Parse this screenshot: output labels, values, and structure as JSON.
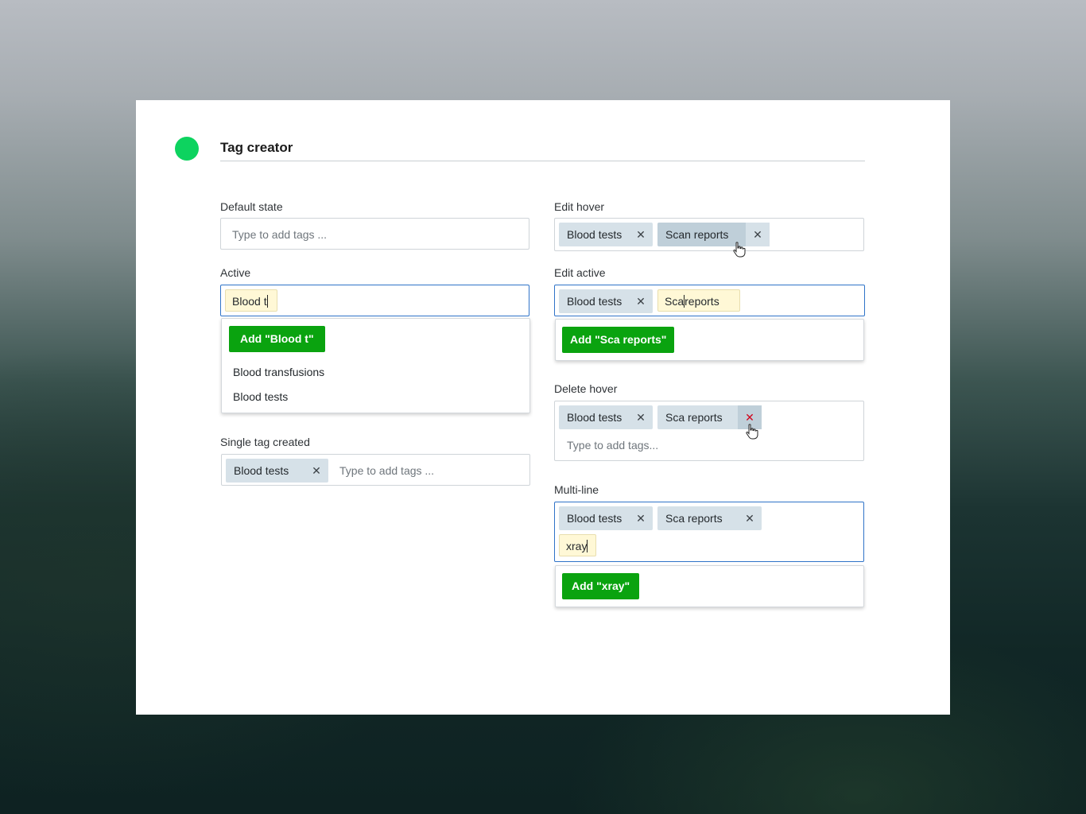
{
  "app": {
    "title": "Tag creator"
  },
  "default": {
    "label": "Default state",
    "placeholder": "Type to add tags ..."
  },
  "active": {
    "label": "Active",
    "input": "Blood t",
    "add_label": "Add \"Blood t\"",
    "options": [
      "Blood transfusions",
      "Blood tests"
    ]
  },
  "single": {
    "label": "Single tag created",
    "tag": "Blood tests",
    "placeholder": "Type to add tags ..."
  },
  "edit_hover": {
    "label": "Edit hover",
    "tags": [
      "Blood tests",
      "Scan reports"
    ]
  },
  "edit_active": {
    "label": "Edit active",
    "tag": "Blood tests",
    "edit_before": "Sca",
    "edit_after": "reports",
    "add_label": "Add \"Sca reports\""
  },
  "delete_hover": {
    "label": "Delete hover",
    "tags": [
      "Blood tests",
      "Sca reports"
    ],
    "placeholder": "Type to add tags..."
  },
  "multi": {
    "label": "Multi-line",
    "tags": [
      "Blood tests",
      "Sca reports"
    ],
    "input": "xray",
    "add_label": "Add \"xray\""
  },
  "icons": {
    "remove": "close-icon",
    "cursor": "hand-pointer-icon",
    "brand": "green-dot-icon"
  },
  "colors": {
    "accent": "#0aa30f",
    "focus": "#2f73c8",
    "brand": "#0dd35f",
    "danger": "#d0021b",
    "tag": "#d6e1e8"
  }
}
